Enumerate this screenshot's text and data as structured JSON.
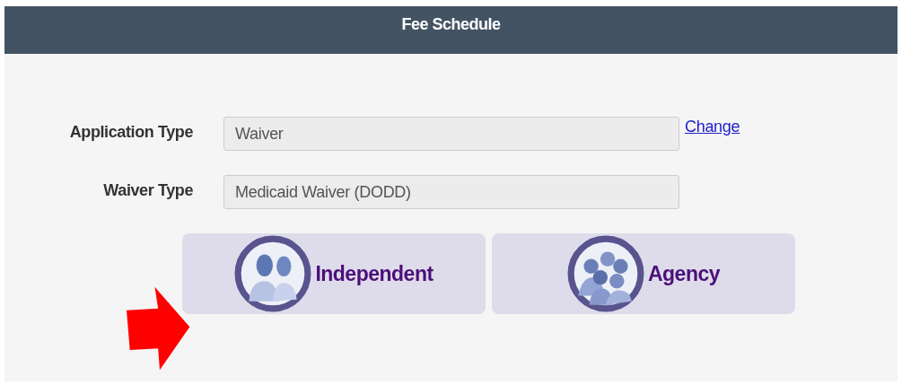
{
  "header": {
    "title": "Fee Schedule"
  },
  "fields": [
    {
      "label": "Application Type",
      "value": "Waiver",
      "link": "Change"
    },
    {
      "label": "Waiver Type",
      "value": "Medicaid Waiver (DODD)"
    }
  ],
  "options": [
    {
      "label": "Independent",
      "kind": "individual"
    },
    {
      "label": "Agency",
      "kind": "group"
    }
  ]
}
